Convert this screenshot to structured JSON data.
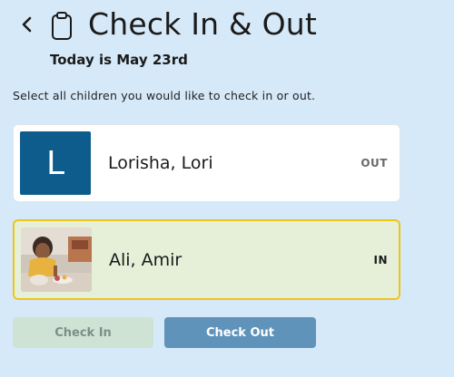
{
  "header": {
    "title": "Check In & Out",
    "date_text": "Today is May 23rd",
    "back_icon": "chevron-left-icon",
    "title_icon": "clipboard-icon"
  },
  "instructions": "Select all children you would like to check in or out.",
  "children": [
    {
      "name": "Lorisha, Lori",
      "avatar_initial": "L",
      "status": "OUT",
      "selected": false
    },
    {
      "name": "Ali, Amir",
      "avatar": "child-photo",
      "status": "IN",
      "selected": true
    }
  ],
  "actions": {
    "check_in_label": "Check In",
    "check_out_label": "Check Out"
  },
  "colors": {
    "background": "#d6e9f8",
    "avatar_initial_bg": "#0e5c8c",
    "selected_card_bg": "#e6f0d9",
    "selected_card_border": "#f0c419",
    "check_in_bg": "#cfe3d4",
    "check_out_bg": "#5f93ba"
  }
}
